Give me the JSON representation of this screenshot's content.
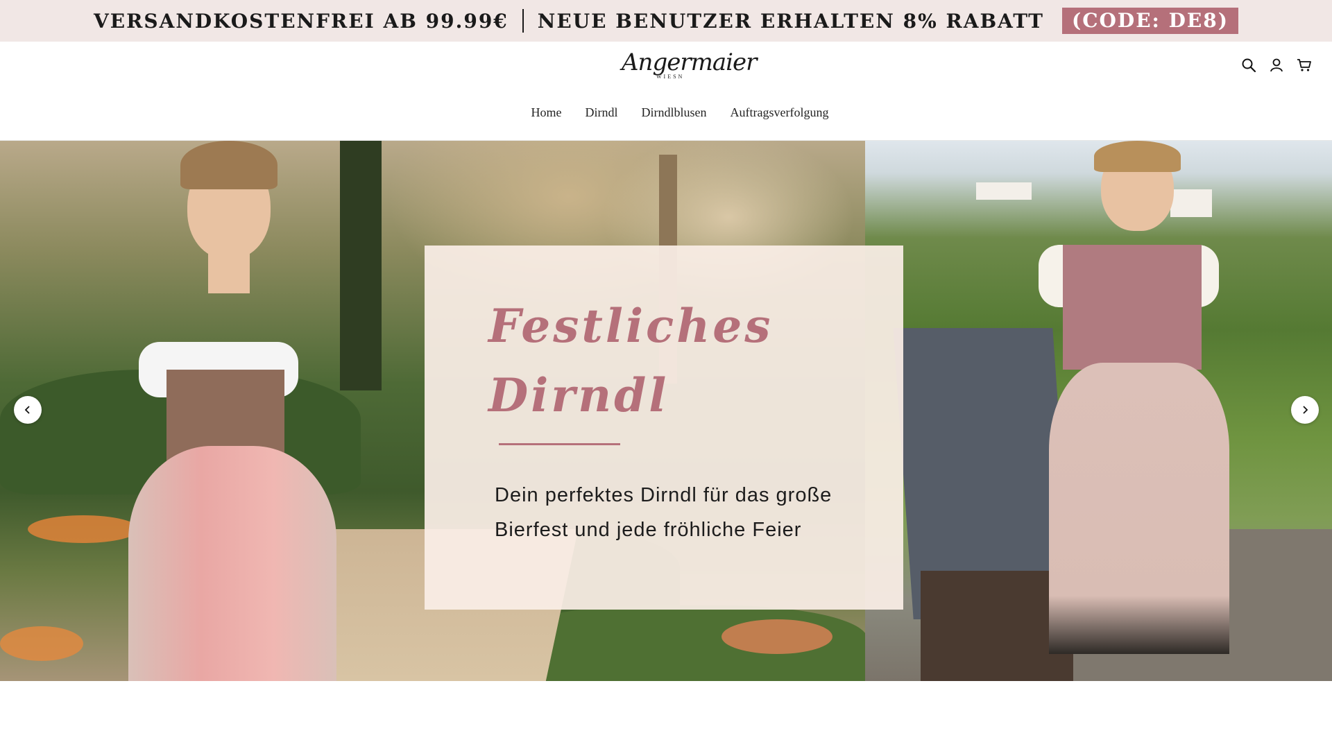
{
  "announcement": {
    "part1": "VERSANDKOSTENFREI AB 99.99€",
    "part2": "NEUE BENUTZER ERHALTEN  8% RABATT",
    "code": "(CODE: DE8)"
  },
  "header": {
    "logo_text": "Angermaier",
    "logo_subtext": "WIESN",
    "icons": [
      "search-icon",
      "account-icon",
      "cart-icon"
    ]
  },
  "nav": {
    "items": [
      {
        "label": "Home"
      },
      {
        "label": "Dirndl"
      },
      {
        "label": "Dirndlblusen"
      },
      {
        "label": "Auftragsverfolgung"
      }
    ]
  },
  "hero": {
    "title_line1": "Festliches",
    "title_line2": "Dirndl",
    "subtitle_line1": "Dein perfektes Dirndl für das große",
    "subtitle_line2": "Bierfest und jede fröhliche Feier",
    "prev_icon": "chevron-left-icon",
    "next_icon": "chevron-right-icon"
  },
  "colors": {
    "accent": "#b5707a",
    "announcement_bg": "#f1e7e5",
    "promo_bg": "#faeee6"
  }
}
